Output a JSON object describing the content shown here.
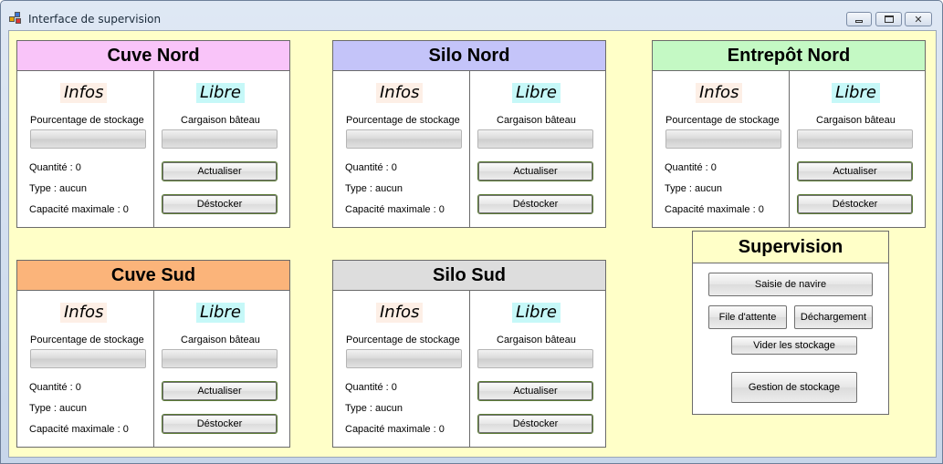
{
  "window": {
    "title": "Interface de supervision",
    "icon": "app-icon"
  },
  "panels": [
    {
      "title": "Cuve Nord",
      "header_color": "#f9c4f9",
      "infos_label": "Infos",
      "libre_label": "Libre",
      "storage_pct_label": "Pourcentage de stockage",
      "storage_pct": 0,
      "cargo_label": "Cargaison bâteau",
      "cargo_pct": 0,
      "quantity_text": "Quantité : 0",
      "type_text": "Type :  aucun",
      "capacity_text": "Capacité maximale :  0",
      "actualiser_label": "Actualiser",
      "destocker_label": "Déstocker"
    },
    {
      "title": "Silo Nord",
      "header_color": "#c4c4f9",
      "infos_label": "Infos",
      "libre_label": "Libre",
      "storage_pct_label": "Pourcentage de stockage",
      "storage_pct": 0,
      "cargo_label": "Cargaison bâteau",
      "cargo_pct": 0,
      "quantity_text": "Quantité : 0",
      "type_text": "Type :  aucun",
      "capacity_text": "Capacité maximale :  0",
      "actualiser_label": "Actualiser",
      "destocker_label": "Déstocker"
    },
    {
      "title": "Entrepôt Nord",
      "header_color": "#c4f9c4",
      "infos_label": "Infos",
      "libre_label": "Libre",
      "storage_pct_label": "Pourcentage de stockage",
      "storage_pct": 0,
      "cargo_label": "Cargaison bâteau",
      "cargo_pct": 0,
      "quantity_text": "Quantité : 0",
      "type_text": "Type :  aucun",
      "capacity_text": "Capacité maximale :  0",
      "actualiser_label": "Actualiser",
      "destocker_label": "Déstocker"
    },
    {
      "title": "Cuve Sud",
      "header_color": "#fbb47a",
      "infos_label": "Infos",
      "libre_label": "Libre",
      "storage_pct_label": "Pourcentage de stockage",
      "storage_pct": 0,
      "cargo_label": "Cargaison bâteau",
      "cargo_pct": 0,
      "quantity_text": "Quantité : 0",
      "type_text": "Type :  aucun",
      "capacity_text": "Capacité maximale :  0",
      "actualiser_label": "Actualiser",
      "destocker_label": "Déstocker"
    },
    {
      "title": "Silo Sud",
      "header_color": "#dddddd",
      "infos_label": "Infos",
      "libre_label": "Libre",
      "storage_pct_label": "Pourcentage de stockage",
      "storage_pct": 0,
      "cargo_label": "Cargaison bâteau",
      "cargo_pct": 0,
      "quantity_text": "Quantité : 0",
      "type_text": "Type :  aucun",
      "capacity_text": "Capacité maximale :  0",
      "actualiser_label": "Actualiser",
      "destocker_label": "Déstocker"
    }
  ],
  "supervision": {
    "title": "Supervision",
    "saisie_label": "Saisie de navire",
    "file_label": "File d'attente",
    "dechargement_label": "Déchargement",
    "vider_label": "Vider les stockage",
    "gestion_label": "Gestion de stockage"
  },
  "colors": {
    "client_bg": "#ffffc8",
    "infos_bg": "#fdefe6",
    "libre_bg": "#c6f8f8"
  }
}
